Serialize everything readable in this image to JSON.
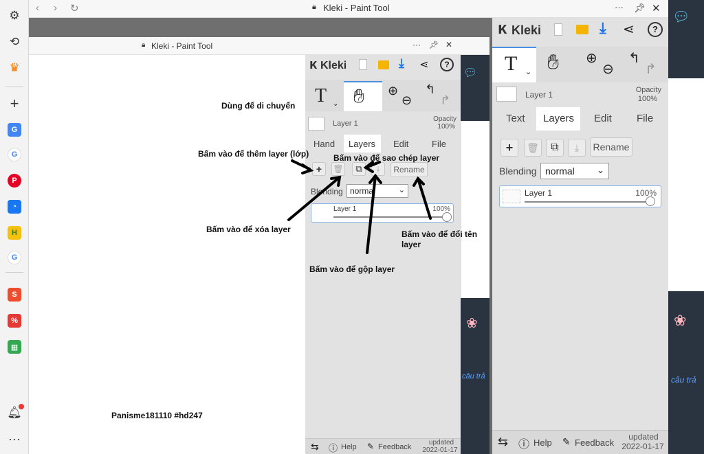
{
  "outer_browser": {
    "title": "Kleki - Paint Tool",
    "menu": "···"
  },
  "inner_browser": {
    "title": "Kleki - Paint Tool",
    "menu": "···"
  },
  "inner_kleki": {
    "logo": "Kleki",
    "layer_name": "Layer 1",
    "opacity_label": "Opacity",
    "opacity_value": "100%",
    "tabs": [
      "Hand",
      "Layers",
      "Edit",
      "File"
    ],
    "rename_label": "Rename",
    "blending_label": "Blending",
    "blending_value": "normal",
    "layer_item_name": "Layer 1",
    "layer_item_opacity": "100%",
    "help_label": "Help",
    "feedback_label": "Feedback",
    "updated_label": "updated",
    "updated_date": "2022-01-17"
  },
  "main_kleki": {
    "logo": "Kleki",
    "layer_name": "Layer 1",
    "opacity_label": "Opacity",
    "opacity_value": "100%",
    "tabs": [
      "Text",
      "Layers",
      "Edit",
      "File"
    ],
    "rename_label": "Rename",
    "blending_label": "Blending",
    "blending_value": "normal",
    "layer_item_name": "Layer 1",
    "layer_item_opacity": "100%",
    "help_label": "Help",
    "feedback_label": "Feedback",
    "updated_label": "updated",
    "updated_date": "2022-01-17"
  },
  "annotations": {
    "move": "Dùng để di chuyển",
    "add_layer": "Bấm vào để thêm layer (lớp)",
    "copy_layer": "Bấm vào để sao chép layer",
    "delete_layer": "Bấm vào để xóa layer",
    "rename_layer_1": "Bấm vào để đổi tên",
    "rename_layer_2": "layer",
    "merge_layer": "Bấm vào để gộp layer",
    "signature": "Panisme181110 #hd247"
  },
  "background_text": "câu trả",
  "colors": {
    "panel": "#e2e2e2",
    "active_tab": "#ffffff",
    "download_icon": "#1a73e8",
    "folder_icon": "#f5b400"
  }
}
